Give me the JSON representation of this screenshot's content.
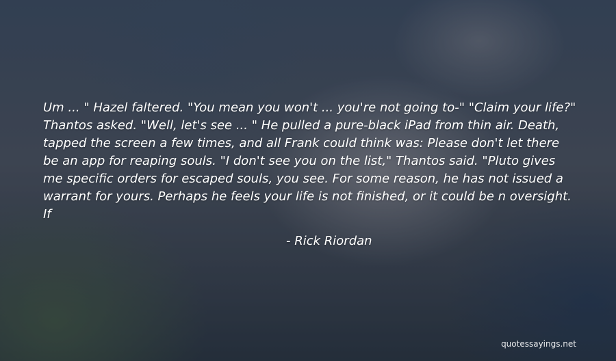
{
  "quote": {
    "text": "Um ... \" Hazel faltered. \"You mean you won't ... you're not going to-\" \"Claim your life?\" Thantos asked. \"Well, let's see ... \" He pulled a pure-black iPad from thin air. Death, tapped the screen a few times, and all Frank could think was: Please don't let there be an app for reaping souls. \"I don't see you on the list,\" Thantos said. \"Pluto gives me specific orders for escaped souls, you see. For some reason, he has not issued a warrant for yours. Perhaps he feels your life is not finished, or it could be n oversight. If",
    "author": "- Rick Riordan"
  },
  "watermark": "quotessayings.net"
}
